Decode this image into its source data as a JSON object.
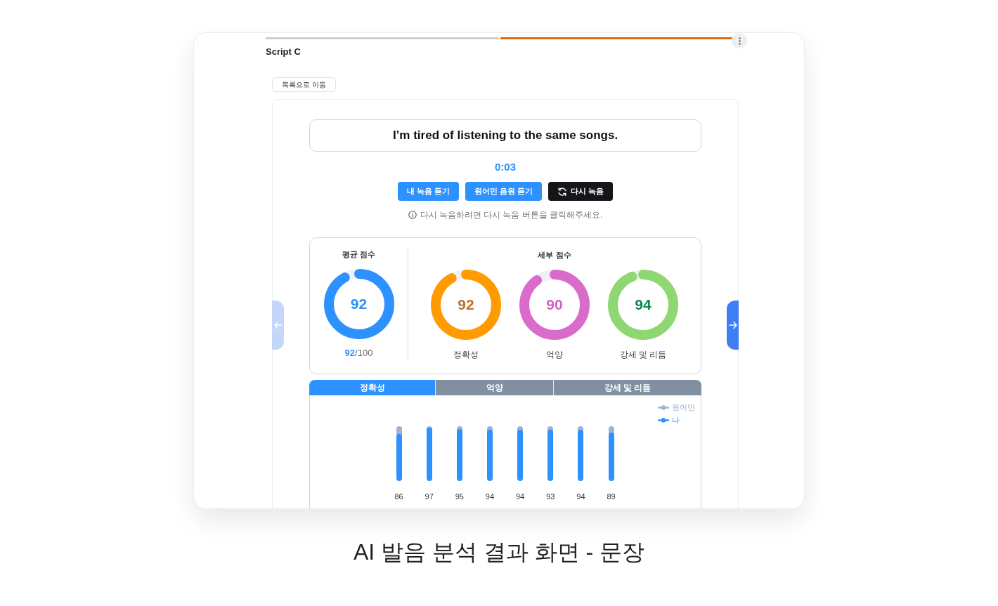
{
  "screen": {
    "progress_steps": [
      {
        "selected": false
      },
      {
        "selected": true
      }
    ],
    "title": "Script C",
    "back_button": "목록으로 이동",
    "sentence": "I’m tired of listening to the same songs.",
    "timer": "0:03",
    "buttons": [
      {
        "label": "내 녹음 듣기",
        "kind": "primary"
      },
      {
        "label": "원어민 음원 듣기",
        "kind": "primary"
      },
      {
        "label": "다시 녹음",
        "kind": "rerecord"
      }
    ],
    "hint": "다시 녹음하려면 다시 녹음 버튼을 클릭해주세요.",
    "nav_buttons": [
      {
        "kind": "previous",
        "disabled": true
      },
      {
        "kind": "next",
        "disabled": false
      }
    ],
    "average_score": {
      "title": "평균 점수",
      "level": 0.92,
      "color": "#2d91ff",
      "value": {
        "text": "92",
        "color": "#2d91ff"
      },
      "score": "92",
      "out_of": "/100"
    },
    "detail_scores": {
      "title": "세부 점수",
      "items": [
        {
          "label": "정확성",
          "level": 0.92,
          "color": "#ff9a00",
          "value": {
            "text": "92",
            "color": "#b8732c"
          }
        },
        {
          "label": "억양",
          "level": 0.9,
          "color": "#d96ccb",
          "value": {
            "text": "90",
            "color": "#d062c4"
          }
        },
        {
          "label": "강세 및 리듬",
          "level": 0.94,
          "color": "#8fd772",
          "value": {
            "text": "94",
            "color": "#0b8a48"
          }
        }
      ]
    },
    "chart_tabs": [
      {
        "label": "정확성",
        "selected": true
      },
      {
        "label": "억양",
        "selected": false
      },
      {
        "label": "강세 및 리듬",
        "selected": false
      }
    ],
    "legend": [
      {
        "label": "원어민",
        "color": "#9fb3cc"
      },
      {
        "label": "나",
        "color": "#2d91ff"
      }
    ],
    "word_scores": [
      {
        "level": 0.86,
        "reading": "86"
      },
      {
        "level": 0.97,
        "reading": "97"
      },
      {
        "level": 0.95,
        "reading": "95"
      },
      {
        "level": 0.94,
        "reading": "94"
      },
      {
        "level": 0.94,
        "reading": "94"
      },
      {
        "level": 0.93,
        "reading": "93"
      },
      {
        "level": 0.94,
        "reading": "94"
      },
      {
        "level": 0.89,
        "reading": "89"
      }
    ]
  },
  "caption": "AI 발음 분석 결과 화면 - 문장"
}
